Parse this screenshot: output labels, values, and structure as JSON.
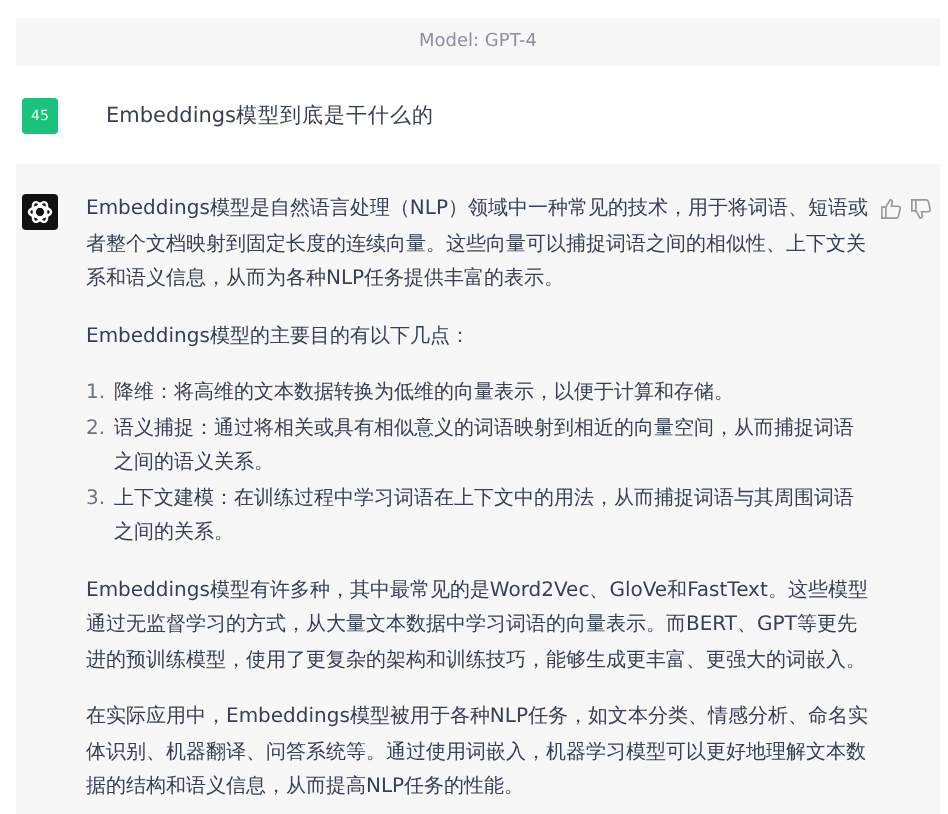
{
  "model_bar": {
    "label": "Model: GPT-4"
  },
  "user_message": {
    "avatar": "45",
    "text": "Embeddings模型到底是干什么的"
  },
  "assistant_message": {
    "blocks": [
      {
        "kind": "paragraph",
        "text": "Embeddings模型是自然语言处理（NLP）领域中一种常见的技术，用于将词语、短语或者整个文档映射到固定长度的连续向量。这些向量可以捕捉词语之间的相似性、上下文关系和语义信息，从而为各种NLP任务提供丰富的表示。"
      },
      {
        "kind": "paragraph",
        "text": "Embeddings模型的主要目的有以下几点："
      },
      {
        "kind": "list",
        "items": [
          {
            "number": "1.",
            "text": "降维：将高维的文本数据转换为低维的向量表示，以便于计算和存储。"
          },
          {
            "number": "2.",
            "text": "语义捕捉：通过将相关或具有相似意义的词语映射到相近的向量空间，从而捕捉词语之间的语义关系。"
          },
          {
            "number": "3.",
            "text": "上下文建模：在训练过程中学习词语在上下文中的用法，从而捕捉词语与其周围词语之间的关系。"
          }
        ]
      },
      {
        "kind": "paragraph",
        "text": "Embeddings模型有许多种，其中最常见的是Word2Vec、GloVe和FastText。这些模型通过无监督学习的方式，从大量文本数据中学习词语的向量表示。而BERT、GPT等更先进的预训练模型，使用了更复杂的架构和训练技巧，能够生成更丰富、更强大的词嵌入。"
      },
      {
        "kind": "paragraph",
        "text": "在实际应用中，Embeddings模型被用于各种NLP任务，如文本分类、情感分析、命名实体识别、机器翻译、问答系统等。通过使用词嵌入，机器学习模型可以更好地理解文本数据的结构和语义信息，从而提高NLP任务的性能。"
      }
    ]
  }
}
